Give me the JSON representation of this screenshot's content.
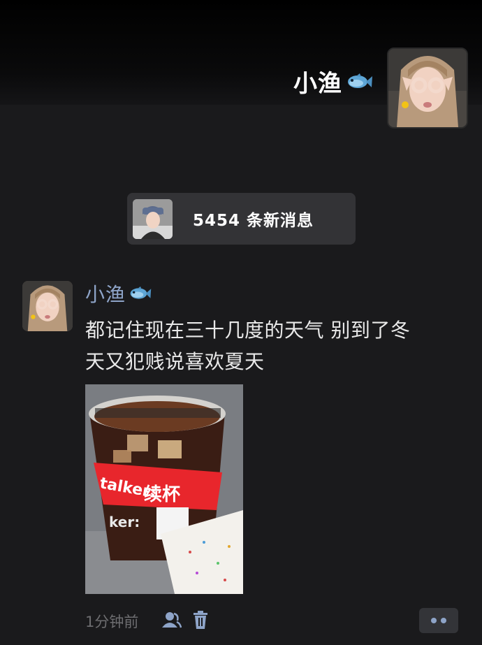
{
  "profile": {
    "name": "小渔",
    "name_emoji": "fish-icon"
  },
  "new_messages": {
    "label": "5454 条新消息"
  },
  "post": {
    "author": "小渔",
    "author_emoji": "fish-icon",
    "text_line1": "都记住现在三十几度的天气 别到了冬",
    "text_line2": "天又犯贱说喜欢夏天",
    "image_cup_text_top": "talker:",
    "image_cup_text_main": "续杯",
    "image_cup_text_bottom": "ker:",
    "timestamp": "1分钟前"
  },
  "colors": {
    "background": "#1a1a1c",
    "name_link": "#8ea4c8",
    "pill": "#333336",
    "cup_red": "#e8262c"
  }
}
